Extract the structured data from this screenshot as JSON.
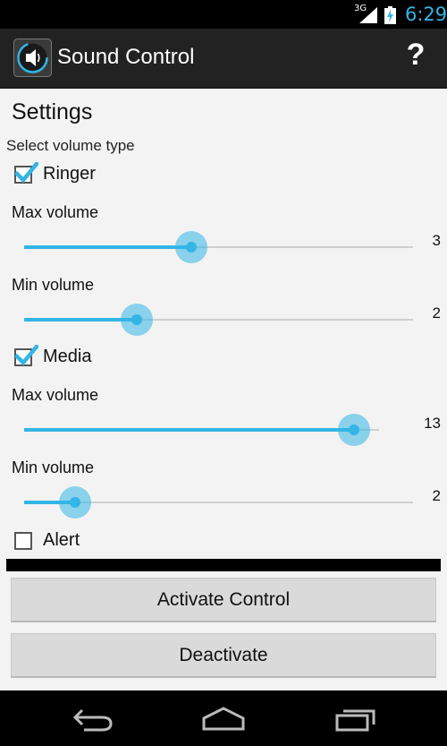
{
  "status_bar": {
    "network": "3G",
    "time": "6:29"
  },
  "action_bar": {
    "title": "Sound Control",
    "help_label": "?"
  },
  "settings": {
    "title": "Settings",
    "select_label": "Select volume type",
    "ringer": {
      "label": "Ringer",
      "checked": true,
      "max": {
        "label": "Max volume",
        "value": "3",
        "fraction": 0.43
      },
      "min": {
        "label": "Min volume",
        "value": "2",
        "fraction": 0.29
      }
    },
    "media": {
      "label": "Media",
      "checked": true,
      "max": {
        "label": "Max volume",
        "value": "13",
        "fraction": 0.93
      },
      "min": {
        "label": "Min volume",
        "value": "2",
        "fraction": 0.13
      }
    },
    "alert": {
      "label": "Alert",
      "checked": false
    }
  },
  "buttons": {
    "activate": "Activate Control",
    "deactivate": "Deactivate"
  },
  "colors": {
    "accent": "#33b5e5",
    "action_bar": "#222222",
    "background": "#f3f3f3"
  }
}
